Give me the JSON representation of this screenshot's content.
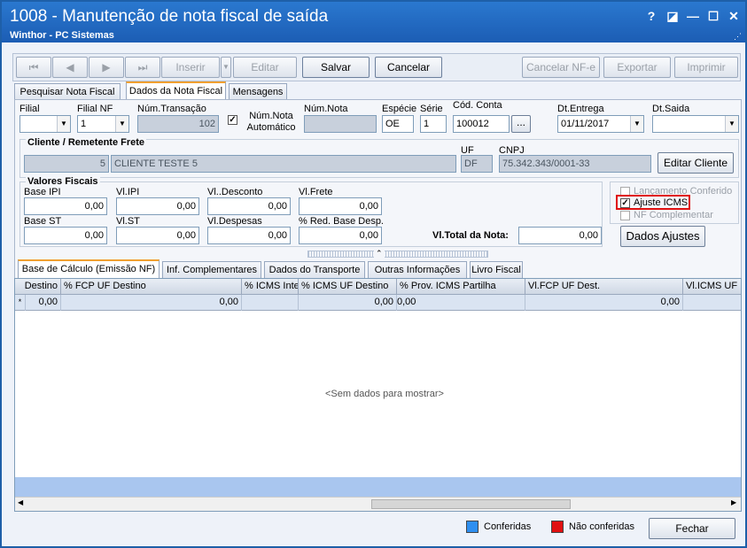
{
  "window": {
    "title": "1008 - Manutenção de nota fiscal de saída",
    "subtitle": "Winthor - PC Sistemas",
    "help_label": "?",
    "restore_label": "◪",
    "minimize_label": "—",
    "maximize_label": "☐",
    "close_label": "✕"
  },
  "toolbar": {
    "first_label": "⏮",
    "prev_label": "◀",
    "next_label": "▶",
    "last_label": "⏭",
    "insert_label": "Inserir",
    "edit_label": "Editar",
    "save_label": "Salvar",
    "cancel_label": "Cancelar",
    "cancel_nfe_label": "Cancelar NF-e",
    "export_label": "Exportar",
    "print_label": "Imprimir"
  },
  "main_tabs": [
    "Pesquisar Nota Fiscal",
    "Dados da Nota Fiscal",
    "Mensagens"
  ],
  "header": {
    "filial_label": "Filial",
    "filial_value": "",
    "filial_nf_label": "Filial NF",
    "filial_nf_value": "1",
    "num_transacao_label": "Núm.Transação",
    "num_transacao_value": "102",
    "num_nota_auto_label": "Núm.Nota Automático",
    "num_nota_auto_checked": true,
    "num_nota_label": "Núm.Nota",
    "num_nota_value": "",
    "especie_label": "Espécie",
    "especie_value": "OE",
    "serie_label": "Série",
    "serie_value": "1",
    "cod_conta_label": "Cód. Conta",
    "cod_conta_value": "100012",
    "ellipsis_label": "...",
    "dt_entrega_label": "Dt.Entrega",
    "dt_entrega_value": "01/11/2017",
    "dt_saida_label": "Dt.Saida",
    "dt_saida_value": ""
  },
  "cliente": {
    "section_label": "Cliente / Remetente Frete",
    "code": "5",
    "name": "CLIENTE TESTE 5",
    "uf_label": "UF",
    "uf_value": "DF",
    "cnpj_label": "CNPJ",
    "cnpj_value": "75.342.343/0001-33",
    "edit_button_label": "Editar Cliente"
  },
  "valores": {
    "section_label": "Valores Fiscais",
    "base_ipi_label": "Base IPI",
    "base_ipi": "0,00",
    "vl_ipi_label": "Vl.IPI",
    "vl_ipi": "0,00",
    "vl_desconto_label": "Vl..Desconto",
    "vl_desconto": "0,00",
    "vl_frete_label": "Vl.Frete",
    "vl_frete": "0,00",
    "base_st_label": "Base ST",
    "base_st": "0,00",
    "vl_st_label": "Vl.ST",
    "vl_st": "0,00",
    "vl_despesas_label": "Vl.Despesas",
    "vl_despesas": "0,00",
    "red_base_label": "% Red. Base Desp.",
    "red_base": "0,00",
    "total_label": "Vl.Total da Nota:",
    "total": "0,00"
  },
  "checks": {
    "lancamento_label": "Lançamento Conferido",
    "lancamento": false,
    "ajuste_label": "Ajuste ICMS",
    "ajuste": true,
    "nf_comp_label": "NF Complementar",
    "nf_comp": false,
    "dados_ajustes_label": "Dados Ajustes"
  },
  "sub_tabs": [
    "Base de Cálculo (Emissão NF)",
    "Inf. Complementares",
    "Dados do Transporte",
    "Outras Informações",
    "Livro Fiscal"
  ],
  "grid": {
    "columns": [
      "Destino",
      "% FCP UF Destino",
      "% ICMS Inte",
      "% ICMS UF Destino",
      "% Prov. ICMS Partilha",
      "Vl.FCP UF Dest.",
      "Vl.ICMS UF D"
    ],
    "row_marker": "*",
    "row": [
      "0,00",
      "0,00",
      "",
      "0,00",
      "0,00",
      "0,00",
      ""
    ],
    "empty_text": "<Sem dados para mostrar>"
  },
  "status": {
    "conferidas_label": "Conferidas",
    "conferidas_color": "#2f8ff0",
    "nao_conferidas_label": "Não conferidas",
    "nao_conferidas_color": "#e01010",
    "close_label": "Fechar"
  }
}
